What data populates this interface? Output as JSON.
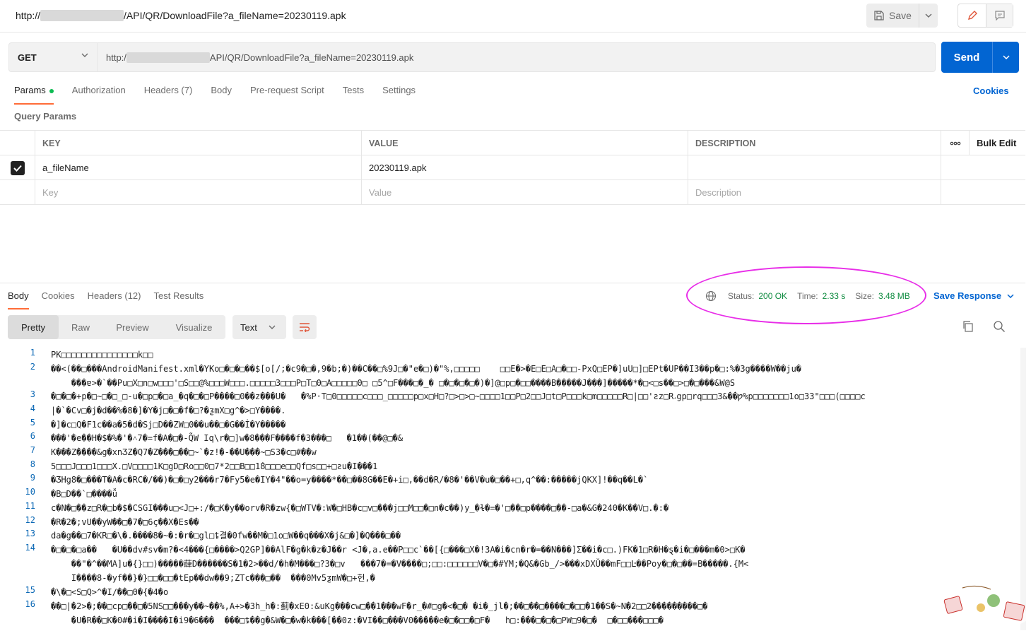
{
  "title_bar": {
    "url_prefix": "http://",
    "url_suffix": "/API/QR/DownloadFile?a_fileName=20230119.apk",
    "save_label": "Save"
  },
  "request": {
    "method": "GET",
    "url_prefix": "http:/",
    "url_suffix": "API/QR/DownloadFile?a_fileName=20230119.apk",
    "send_label": "Send"
  },
  "request_tabs": [
    {
      "label": "Params",
      "active": true
    },
    {
      "label": "Authorization"
    },
    {
      "label": "Headers (7)"
    },
    {
      "label": "Body"
    },
    {
      "label": "Pre-request Script"
    },
    {
      "label": "Tests"
    },
    {
      "label": "Settings"
    }
  ],
  "cookies_link": "Cookies",
  "query_params_label": "Query Params",
  "params_table": {
    "headers": {
      "key": "KEY",
      "value": "VALUE",
      "description": "DESCRIPTION",
      "bulk_edit": "Bulk Edit",
      "more": "ooo"
    },
    "rows": [
      {
        "checked": true,
        "key": "a_fileName",
        "value": "20230119.apk",
        "description": ""
      }
    ],
    "placeholders": {
      "key": "Key",
      "value": "Value",
      "description": "Description"
    }
  },
  "response_tabs": [
    {
      "label": "Body",
      "active": true
    },
    {
      "label": "Cookies"
    },
    {
      "label": "Headers (12)"
    },
    {
      "label": "Test Results"
    }
  ],
  "response_status": {
    "status_label": "Status:",
    "status_value": "200 OK",
    "time_label": "Time:",
    "time_value": "2.33 s",
    "size_label": "Size:",
    "size_value": "3.48 MB",
    "save_response_label": "Save Response"
  },
  "format_tabs": [
    {
      "label": "Pretty",
      "active": true
    },
    {
      "label": "Raw"
    },
    {
      "label": "Preview"
    },
    {
      "label": "Visualize"
    }
  ],
  "text_select_label": "Text",
  "code_lines": [
    {
      "n": "1",
      "text": "PK□□□□□□□□□□□□□□□k□□"
    },
    {
      "n": "2",
      "text": "��<(��□���AndroidManifest.xml�YKo□�□�□��$[o[/;�c9�□�,9�b;�)��C��□%9J□�\"e�□)�\"%,□□□□□    □□E�>�E□E□A□�□□-PxQ□EP�]uU□]□EPt�UP��I3��p�□:%�3g����W��ju�"
    },
    {
      "n": "",
      "text": "    ���ɐ>�`��Pu□X□n□w□□□'□S□□@%□□□W□□□.□□□□□3□□□P□T□0□A□□□□□0□ □5^□F���□�_� □�□�□�□�)�]@□p□�□□����B�����J���]�����*�□<□s��□>□�□���&W@S"
    },
    {
      "n": "3",
      "text": "�□�□�+p�□~□�□_□-u�□p□�□a_�q�□�□P����□0��z���U�   �%P·T□0□□□□□c□□□_□□□□□p□x□H□?□>□>□~□□□□1□□P□2□□J□t□P□□□k□m□□□□□R□|□□'ƨz□R˔gp□rq□□□3&��ƿ%p□□□□□□□1o□33\"□□□(□□□□c"
    },
    {
      "n": "4",
      "text": "|�`�Cv□�j�d��%�8�]�Y�j□�□�f�□?�ƺmX□g^�>□Y����."
    },
    {
      "n": "5",
      "text": "�]�c□Q�F1c��a�5�d�Sj□D��ZW□0��u��□�G��İ�Y�����"
    },
    {
      "n": "6",
      "text": "���'�e��H�$�%�'�˄7�=f�A�□�-Q̃W Iq\\r�□]w�8���F����f�3���□   �1��(��@□�&"
    },
    {
      "n": "7",
      "text": "K���Z����&g�xnƷZ�Q7�Z���□��□~`�z!�-��U���~□S3�c□#��w"
    },
    {
      "n": "8",
      "text": "5□□□J□□□1□□□X.□V□□□□1K□gD□Ro□□0□7*2□□B□□1̂8□□□e□□Qf□s□□+□ƨu�I���1"
    },
    {
      "n": "9",
      "text": "�ƷHg8�□���T�A�c�RC�/��)�□�□y2���r7�Fy5�e�IY�4\"��o=y����*��□��8G��E�+i□,��d�R/�8�'��V�u�□��+□,q^��:�����jQKX]!��q��L�`"
    },
    {
      "n": "10",
      "text": "�B□D��`□����ǚ"
    },
    {
      "n": "11",
      "text": "c�N�□��z□R�□b�$�CSGI���u□<J□+:/�□K�y��orv�R�zw{�□WTV�:W�□HB�c□v□���j□□M□□�□n�c��)y_�ɫ�=�'□��□p����□��-□a�&G�240�K��V□.�:�"
    },
    {
      "n": "12",
      "text": "�R�2�;vU��yW��□�7�□6ç��X�Es��"
    },
    {
      "n": "13",
      "text": "da�g��□7�KR□�\\�.����8�~�:�r�□gl□ȶ결�0fw��M�□1o□W��q���X�j&□�]�Q���□��"
    },
    {
      "n": "14",
      "text": "�□�□�□a��   �U��dv#sv�m?�<4���{□����>Q2GP]��AlF�g�k�z�J��r <J�,a.e��P□□c`��[{□���□X�!3A�i�cn�r�=��N���]Ʃ��i�c□.)FK�1□R�H�ȿ�i�□���m�0>□K�"
    },
    {
      "n": "",
      "text": "    ��\"�^��MA]u�{}□□)�����蕼D������S�1�2>��d/�h�M���□?3�□v   ���7�=�V����□;□□:□□□□□□V�□�#YM;�Q&�Gb_/>���xDXŬ��mF□□Ŀ��Poy�□�□��=B�����.{M<"
    },
    {
      "n": "",
      "text": "    I����8-�yf��}�}□□�□□�tEp��dw��9;ZTc���□��  ���0Mv5ƺmW�□+헌,�"
    },
    {
      "n": "15",
      "text": "�\\�□<S□Q>^�I∕��□0�{�4�o"
    },
    {
      "n": "16",
      "text": "��□|�2>�;��□cp□��□�5NS□□���y��~��%,A+>�3h_h�:蓟�xE0:&uKg���cw□��1���wF�r_�#□g�<�□� �i�_jl�;��□��□����□�□□�1��S�~N�2□□2���������□�"
    },
    {
      "n": "",
      "text": "    �U�R��□K�0#�i�I����I�i9�6���  ���□ȶ��g�&W�□�w�k���[��0z:�VI��□���V0�����e�□�□□�□F�   h□:���□�□�□PW□9�□�  □�□□���□□□�"
    }
  ]
}
